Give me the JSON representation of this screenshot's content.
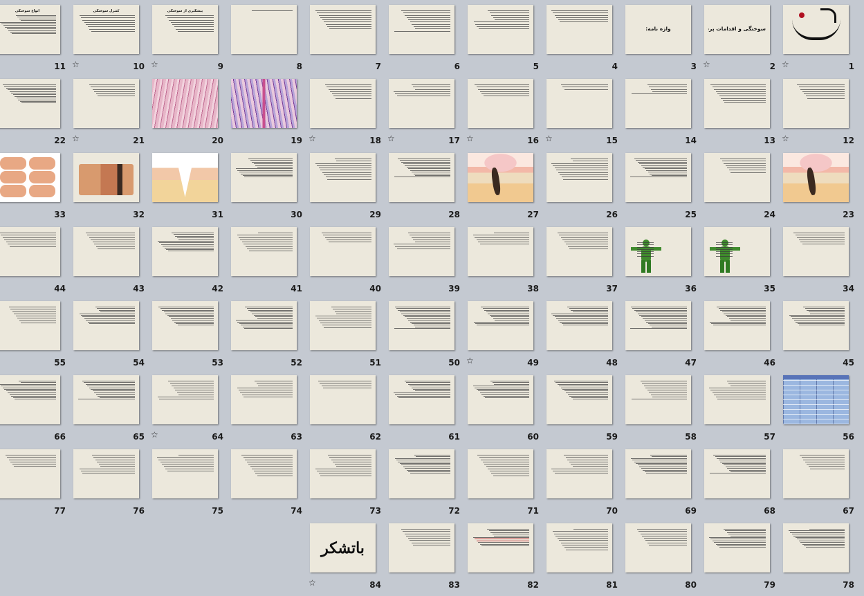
{
  "view": "slide-sorter",
  "slides": [
    {
      "n": "1",
      "kind": "logo",
      "star": true
    },
    {
      "n": "2",
      "kind": "title",
      "title": "سوختگی و اقدامات پرستاری",
      "star": true
    },
    {
      "n": "3",
      "kind": "title",
      "title": "واژه نامه:",
      "star": false
    },
    {
      "n": "4",
      "kind": "text",
      "lines": 6,
      "star": false
    },
    {
      "n": "5",
      "kind": "text",
      "lines": 9,
      "star": false
    },
    {
      "n": "6",
      "kind": "text",
      "lines": 10,
      "star": false
    },
    {
      "n": "7",
      "kind": "text",
      "title": "",
      "lines": 9,
      "star": false
    },
    {
      "n": "8",
      "kind": "text",
      "lines": 1,
      "star": false
    },
    {
      "n": "9",
      "kind": "text",
      "title": "پیشگیری از سوختگی",
      "lines": 8,
      "star": true
    },
    {
      "n": "10",
      "kind": "text",
      "title": "کنترل سوختگی",
      "lines": 8,
      "star": true
    },
    {
      "n": "11",
      "kind": "text",
      "title": "انواع سوختگی",
      "lines": 12,
      "star": true
    },
    {
      "n": "12",
      "kind": "text",
      "title": "",
      "lines": 7,
      "star": true
    },
    {
      "n": "13",
      "kind": "text",
      "title": "",
      "lines": 9,
      "star": false
    },
    {
      "n": "14",
      "kind": "text",
      "title": "",
      "lines": 5,
      "star": false
    },
    {
      "n": "15",
      "kind": "text",
      "title": "",
      "lines": 3,
      "star": true
    },
    {
      "n": "16",
      "kind": "text",
      "title": "",
      "lines": 6,
      "star": true
    },
    {
      "n": "17",
      "kind": "text",
      "title": "",
      "lines": 6,
      "star": true
    },
    {
      "n": "18",
      "kind": "text",
      "title": "",
      "lines": 7,
      "star": true
    },
    {
      "n": "19",
      "kind": "histo-purple",
      "star": false
    },
    {
      "n": "20",
      "kind": "histo",
      "star": false
    },
    {
      "n": "21",
      "kind": "text",
      "title": "",
      "lines": 6,
      "star": true
    },
    {
      "n": "22",
      "kind": "text",
      "title": "",
      "lines": 12,
      "star": false
    },
    {
      "n": "23",
      "kind": "skin",
      "star": false
    },
    {
      "n": "24",
      "kind": "text",
      "title": "",
      "lines": 7,
      "star": false
    },
    {
      "n": "25",
      "kind": "text",
      "title": "",
      "lines": 12,
      "star": false
    },
    {
      "n": "26",
      "kind": "text",
      "lines": 10,
      "star": false
    },
    {
      "n": "27",
      "kind": "skin",
      "star": false
    },
    {
      "n": "28",
      "kind": "text",
      "title": "",
      "lines": 12,
      "star": false
    },
    {
      "n": "29",
      "kind": "text",
      "lines": 10,
      "star": false
    },
    {
      "n": "30",
      "kind": "text",
      "title": "",
      "lines": 12,
      "star": false
    },
    {
      "n": "31",
      "kind": "vcut",
      "star": false
    },
    {
      "n": "32",
      "kind": "burnphoto",
      "star": false
    },
    {
      "n": "33",
      "kind": "hands",
      "star": false
    },
    {
      "n": "34",
      "kind": "text",
      "title": "",
      "lines": 6,
      "star": false
    },
    {
      "n": "35",
      "kind": "green",
      "title": "",
      "star": false
    },
    {
      "n": "36",
      "kind": "green",
      "title": "",
      "star": false
    },
    {
      "n": "37",
      "kind": "text",
      "title": "",
      "lines": 8,
      "star": false
    },
    {
      "n": "38",
      "kind": "text",
      "lines": 6,
      "star": false
    },
    {
      "n": "39",
      "kind": "text",
      "title": "",
      "lines": 8,
      "star": false
    },
    {
      "n": "40",
      "kind": "text",
      "title": "",
      "lines": 5,
      "star": false
    },
    {
      "n": "41",
      "kind": "text",
      "title": "",
      "lines": 9,
      "star": false
    },
    {
      "n": "42",
      "kind": "text",
      "title": "",
      "lines": 12,
      "star": false
    },
    {
      "n": "43",
      "kind": "text",
      "title": "",
      "lines": 8,
      "star": false
    },
    {
      "n": "44",
      "kind": "text",
      "title": "",
      "lines": 7,
      "star": false
    },
    {
      "n": "45",
      "kind": "text",
      "title": "",
      "lines": 12,
      "star": false
    },
    {
      "n": "46",
      "kind": "text",
      "title": "",
      "lines": 12,
      "star": false
    },
    {
      "n": "47",
      "kind": "text",
      "lines": 14,
      "star": false
    },
    {
      "n": "48",
      "kind": "text",
      "title": "",
      "lines": 12,
      "star": false
    },
    {
      "n": "49",
      "kind": "text",
      "title": "",
      "lines": 12,
      "star": true
    },
    {
      "n": "50",
      "kind": "text",
      "lines": 14,
      "star": false
    },
    {
      "n": "51",
      "kind": "text",
      "title": "",
      "lines": 10,
      "star": false
    },
    {
      "n": "52",
      "kind": "text",
      "lines": 14,
      "star": false
    },
    {
      "n": "53",
      "kind": "text",
      "title": "",
      "lines": 12,
      "star": false
    },
    {
      "n": "54",
      "kind": "text",
      "title": "",
      "lines": 11,
      "star": false
    },
    {
      "n": "55",
      "kind": "text",
      "lines": 8,
      "star": false
    },
    {
      "n": "56",
      "kind": "table",
      "star": false
    },
    {
      "n": "57",
      "kind": "text",
      "title": "",
      "lines": 9,
      "star": false
    },
    {
      "n": "58",
      "kind": "text",
      "lines": 9,
      "star": false
    },
    {
      "n": "59",
      "kind": "text",
      "title": "",
      "lines": 12,
      "star": false
    },
    {
      "n": "60",
      "kind": "text",
      "title": "",
      "lines": 11,
      "star": false
    },
    {
      "n": "61",
      "kind": "text",
      "title": "",
      "lines": 11,
      "star": false
    },
    {
      "n": "62",
      "kind": "text",
      "lines": 4,
      "star": false
    },
    {
      "n": "63",
      "kind": "text",
      "title": "",
      "lines": 8,
      "star": false
    },
    {
      "n": "64",
      "kind": "text",
      "title": "",
      "lines": 9,
      "star": true
    },
    {
      "n": "65",
      "kind": "text",
      "lines": 12,
      "star": false
    },
    {
      "n": "66",
      "kind": "text",
      "title": "",
      "lines": 12,
      "star": false
    },
    {
      "n": "67",
      "kind": "text",
      "title": "",
      "lines": 7,
      "star": false
    },
    {
      "n": "68",
      "kind": "text",
      "lines": 12,
      "star": false
    },
    {
      "n": "69",
      "kind": "text",
      "lines": 12,
      "star": false
    },
    {
      "n": "70",
      "kind": "text",
      "title": "",
      "lines": 9,
      "star": false
    },
    {
      "n": "71",
      "kind": "text",
      "lines": 10,
      "star": false
    },
    {
      "n": "72",
      "kind": "text",
      "lines": 12,
      "star": false
    },
    {
      "n": "73",
      "kind": "text",
      "title": "",
      "lines": 10,
      "star": false
    },
    {
      "n": "74",
      "kind": "text",
      "title": "",
      "lines": 10,
      "star": false
    },
    {
      "n": "75",
      "kind": "text",
      "title": "",
      "lines": 8,
      "star": false
    },
    {
      "n": "76",
      "kind": "text",
      "title": "",
      "lines": 9,
      "star": false
    },
    {
      "n": "77",
      "kind": "text",
      "lines": 6,
      "star": false
    },
    {
      "n": "78",
      "kind": "text",
      "title": "",
      "lines": 12,
      "star": false
    },
    {
      "n": "79",
      "kind": "text",
      "lines": 12,
      "star": false
    },
    {
      "n": "80",
      "kind": "text",
      "lines": 8,
      "star": false
    },
    {
      "n": "81",
      "kind": "text",
      "title": "",
      "lines": 10,
      "star": false
    },
    {
      "n": "82",
      "kind": "text",
      "title": "",
      "lines": 11,
      "redline": true,
      "star": false
    },
    {
      "n": "83",
      "kind": "text",
      "lines": 8,
      "star": false
    },
    {
      "n": "84",
      "kind": "thanks",
      "title": "باتشکر",
      "star": true
    }
  ]
}
